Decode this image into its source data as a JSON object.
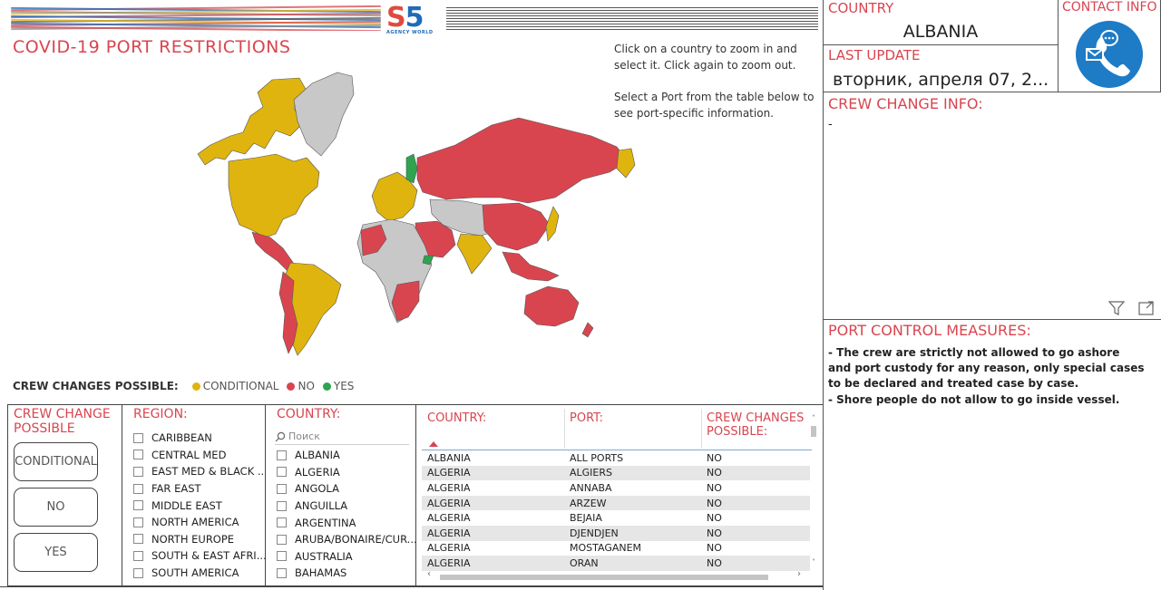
{
  "header": {
    "logo_text": "S5",
    "logo_tagline": "AGENCY WORLD",
    "title": "COVID-19 PORT RESTRICTIONS",
    "instruction_1": "Click on a country to zoom in and select it. Click again to zoom out.",
    "instruction_2": "Select a Port from the table below to see port-specific information."
  },
  "legend": {
    "label": "CREW CHANGES POSSIBLE:",
    "items": [
      {
        "label": "CONDITIONAL",
        "color": "#e0b40f"
      },
      {
        "label": "NO",
        "color": "#d9454f"
      },
      {
        "label": "YES",
        "color": "#2ea44f"
      }
    ]
  },
  "colors": {
    "accent_red": "#d9454f",
    "conditional": "#e0b40f",
    "no": "#d9454f",
    "yes": "#2ea44f",
    "unknown": "#c8c8c8",
    "contact_icon": "#1e7bc6"
  },
  "crew_change_filter": {
    "title": "CREW CHANGE POSSIBLE",
    "buttons": [
      "CONDITIONAL",
      "NO",
      "YES"
    ]
  },
  "region_filter": {
    "title": "REGION:",
    "items": [
      "CARIBBEAN",
      "CENTRAL MED",
      "EAST MED & BLACK ...",
      "FAR EAST",
      "MIDDLE EAST",
      "NORTH AMERICA",
      "NORTH EUROPE",
      "SOUTH & EAST AFRI...",
      "SOUTH AMERICA"
    ]
  },
  "country_filter": {
    "title": "COUNTRY:",
    "search_placeholder": "Поиск",
    "items": [
      "ALBANIA",
      "ALGERIA",
      "ANGOLA",
      "ANGUILLA",
      "ARGENTINA",
      "ARUBA/BONAIRE/CUR...",
      "AUSTRALIA",
      "BAHAMAS"
    ]
  },
  "port_table": {
    "headers": [
      "COUNTRY:",
      "PORT:",
      "CREW CHANGES POSSIBLE:"
    ],
    "rows": [
      [
        "ALBANIA",
        "ALL PORTS",
        "NO"
      ],
      [
        "ALGERIA",
        "ALGIERS",
        "NO"
      ],
      [
        "ALGERIA",
        "ANNABA",
        "NO"
      ],
      [
        "ALGERIA",
        "ARZEW",
        "NO"
      ],
      [
        "ALGERIA",
        "BEJAIA",
        "NO"
      ],
      [
        "ALGERIA",
        "DJENDJEN",
        "NO"
      ],
      [
        "ALGERIA",
        "MOSTAGANEM",
        "NO"
      ],
      [
        "ALGERIA",
        "ORAN",
        "NO"
      ]
    ]
  },
  "country_card": {
    "label": "COUNTRY",
    "value": "ALBANIA"
  },
  "last_update": {
    "label": "LAST UPDATE",
    "value": "вторник, апреля 07, 2..."
  },
  "contact": {
    "label": "CONTACT INFO"
  },
  "crew_change_info": {
    "label": "CREW CHANGE INFO:",
    "value": "-"
  },
  "port_control": {
    "label": "PORT CONTROL MEASURES:",
    "line_1": " - The crew are strictly not allowed to go ashore and port custody for any reason, only special cases to be declared and treated case by case.",
    "line_2": " - Shore people do not allow to go inside vessel."
  },
  "icons": [
    "filter-icon",
    "expand-icon",
    "search-icon",
    "sort-arrow-icon",
    "phone-icon",
    "chat-bubble-icon",
    "envelope-icon"
  ]
}
